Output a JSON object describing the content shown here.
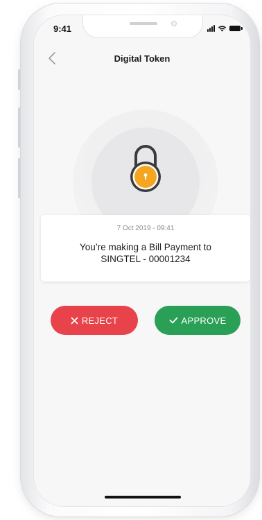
{
  "status_bar": {
    "time": "9:41"
  },
  "nav": {
    "title": "Digital Token"
  },
  "card": {
    "timestamp": "7 Oct 2019 - 09:41",
    "message_line1": "You’re making a Bill Payment to",
    "message_line2": "SINGTEL - 00001234"
  },
  "actions": {
    "reject_label": "REJECT",
    "approve_label": "APPROVE"
  },
  "colors": {
    "reject": "#e8434a",
    "approve": "#2aa056",
    "lock_body": "#f4a621",
    "lock_outline": "#3a3a3c"
  },
  "icons": {
    "back": "chevron-left-icon",
    "lock": "padlock-icon",
    "reject": "x-icon",
    "approve": "checkmark-icon"
  }
}
